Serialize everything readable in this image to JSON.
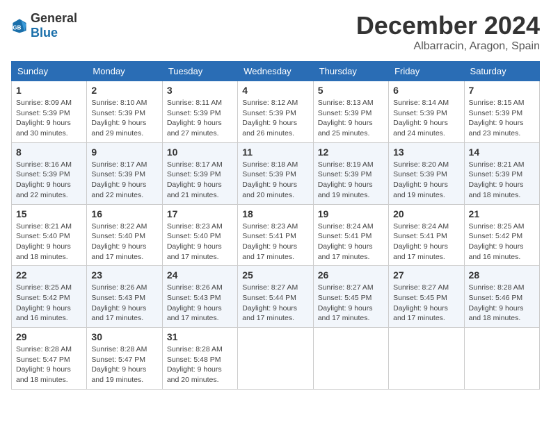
{
  "logo": {
    "general": "General",
    "blue": "Blue"
  },
  "header": {
    "month": "December 2024",
    "location": "Albarracin, Aragon, Spain"
  },
  "weekdays": [
    "Sunday",
    "Monday",
    "Tuesday",
    "Wednesday",
    "Thursday",
    "Friday",
    "Saturday"
  ],
  "weeks": [
    [
      {
        "day": "1",
        "sunrise": "8:09 AM",
        "sunset": "5:39 PM",
        "daylight": "9 hours and 30 minutes."
      },
      {
        "day": "2",
        "sunrise": "8:10 AM",
        "sunset": "5:39 PM",
        "daylight": "9 hours and 29 minutes."
      },
      {
        "day": "3",
        "sunrise": "8:11 AM",
        "sunset": "5:39 PM",
        "daylight": "9 hours and 27 minutes."
      },
      {
        "day": "4",
        "sunrise": "8:12 AM",
        "sunset": "5:39 PM",
        "daylight": "9 hours and 26 minutes."
      },
      {
        "day": "5",
        "sunrise": "8:13 AM",
        "sunset": "5:39 PM",
        "daylight": "9 hours and 25 minutes."
      },
      {
        "day": "6",
        "sunrise": "8:14 AM",
        "sunset": "5:39 PM",
        "daylight": "9 hours and 24 minutes."
      },
      {
        "day": "7",
        "sunrise": "8:15 AM",
        "sunset": "5:39 PM",
        "daylight": "9 hours and 23 minutes."
      }
    ],
    [
      {
        "day": "8",
        "sunrise": "8:16 AM",
        "sunset": "5:39 PM",
        "daylight": "9 hours and 22 minutes."
      },
      {
        "day": "9",
        "sunrise": "8:17 AM",
        "sunset": "5:39 PM",
        "daylight": "9 hours and 22 minutes."
      },
      {
        "day": "10",
        "sunrise": "8:17 AM",
        "sunset": "5:39 PM",
        "daylight": "9 hours and 21 minutes."
      },
      {
        "day": "11",
        "sunrise": "8:18 AM",
        "sunset": "5:39 PM",
        "daylight": "9 hours and 20 minutes."
      },
      {
        "day": "12",
        "sunrise": "8:19 AM",
        "sunset": "5:39 PM",
        "daylight": "9 hours and 19 minutes."
      },
      {
        "day": "13",
        "sunrise": "8:20 AM",
        "sunset": "5:39 PM",
        "daylight": "9 hours and 19 minutes."
      },
      {
        "day": "14",
        "sunrise": "8:21 AM",
        "sunset": "5:39 PM",
        "daylight": "9 hours and 18 minutes."
      }
    ],
    [
      {
        "day": "15",
        "sunrise": "8:21 AM",
        "sunset": "5:40 PM",
        "daylight": "9 hours and 18 minutes."
      },
      {
        "day": "16",
        "sunrise": "8:22 AM",
        "sunset": "5:40 PM",
        "daylight": "9 hours and 17 minutes."
      },
      {
        "day": "17",
        "sunrise": "8:23 AM",
        "sunset": "5:40 PM",
        "daylight": "9 hours and 17 minutes."
      },
      {
        "day": "18",
        "sunrise": "8:23 AM",
        "sunset": "5:41 PM",
        "daylight": "9 hours and 17 minutes."
      },
      {
        "day": "19",
        "sunrise": "8:24 AM",
        "sunset": "5:41 PM",
        "daylight": "9 hours and 17 minutes."
      },
      {
        "day": "20",
        "sunrise": "8:24 AM",
        "sunset": "5:41 PM",
        "daylight": "9 hours and 17 minutes."
      },
      {
        "day": "21",
        "sunrise": "8:25 AM",
        "sunset": "5:42 PM",
        "daylight": "9 hours and 16 minutes."
      }
    ],
    [
      {
        "day": "22",
        "sunrise": "8:25 AM",
        "sunset": "5:42 PM",
        "daylight": "9 hours and 16 minutes."
      },
      {
        "day": "23",
        "sunrise": "8:26 AM",
        "sunset": "5:43 PM",
        "daylight": "9 hours and 17 minutes."
      },
      {
        "day": "24",
        "sunrise": "8:26 AM",
        "sunset": "5:43 PM",
        "daylight": "9 hours and 17 minutes."
      },
      {
        "day": "25",
        "sunrise": "8:27 AM",
        "sunset": "5:44 PM",
        "daylight": "9 hours and 17 minutes."
      },
      {
        "day": "26",
        "sunrise": "8:27 AM",
        "sunset": "5:45 PM",
        "daylight": "9 hours and 17 minutes."
      },
      {
        "day": "27",
        "sunrise": "8:27 AM",
        "sunset": "5:45 PM",
        "daylight": "9 hours and 17 minutes."
      },
      {
        "day": "28",
        "sunrise": "8:28 AM",
        "sunset": "5:46 PM",
        "daylight": "9 hours and 18 minutes."
      }
    ],
    [
      {
        "day": "29",
        "sunrise": "8:28 AM",
        "sunset": "5:47 PM",
        "daylight": "9 hours and 18 minutes."
      },
      {
        "day": "30",
        "sunrise": "8:28 AM",
        "sunset": "5:47 PM",
        "daylight": "9 hours and 19 minutes."
      },
      {
        "day": "31",
        "sunrise": "8:28 AM",
        "sunset": "5:48 PM",
        "daylight": "9 hours and 20 minutes."
      },
      null,
      null,
      null,
      null
    ]
  ],
  "labels": {
    "sunrise": "Sunrise:",
    "sunset": "Sunset:",
    "daylight": "Daylight:"
  }
}
